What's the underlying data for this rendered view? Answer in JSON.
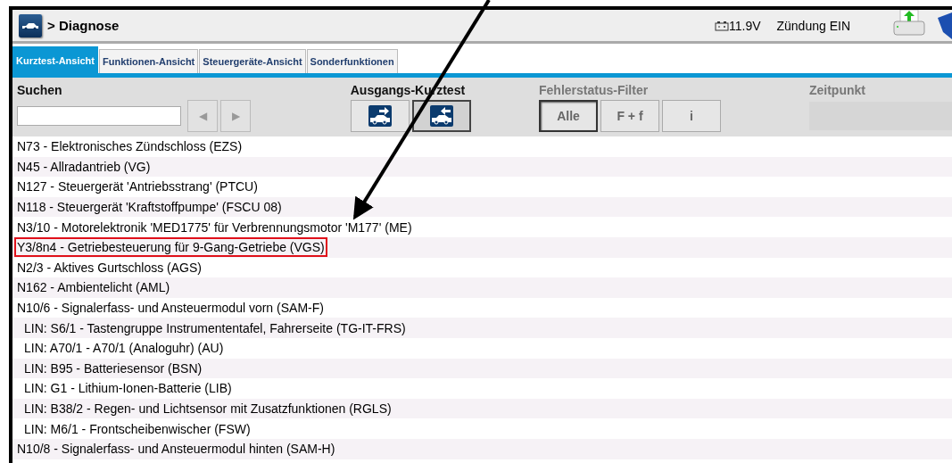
{
  "header": {
    "breadcrumb": "> Diagnose",
    "voltage": "11.9V",
    "ignition": "Zündung EIN"
  },
  "tabs": [
    {
      "label": "Kurztest-Ansicht",
      "selected": true
    },
    {
      "label": "Funktionen-Ansicht",
      "selected": false
    },
    {
      "label": "Steuergeräte-Ansicht",
      "selected": false
    },
    {
      "label": "Sonderfunktionen",
      "selected": false
    }
  ],
  "search": {
    "label": "Suchen"
  },
  "nav_buttons": [
    {
      "symbol": "◀",
      "disabled": true
    },
    {
      "symbol": "▶",
      "disabled": true
    }
  ],
  "ausgangs_kurztest": {
    "label": "Ausgangs-Kurztest",
    "buttons": [
      {
        "kind": "outgoing",
        "selected": false
      },
      {
        "kind": "incoming",
        "selected": true
      }
    ]
  },
  "fehlerstatus_filter": {
    "label": "Fehlerstatus-Filter",
    "buttons": [
      {
        "label": "Alle",
        "selected": true
      },
      {
        "label": "F + f",
        "selected": false
      },
      {
        "label": "i",
        "selected": false
      }
    ]
  },
  "zeitpunkt": {
    "label": "Zeitpunkt"
  },
  "ecus": [
    {
      "label": "N73 - Elektronisches Zündschloss (EZS)",
      "highlighted": false
    },
    {
      "label": "N45 - Allradantrieb (VG)",
      "highlighted": false
    },
    {
      "label": "N127 - Steuergerät 'Antriebsstrang' (PTCU)",
      "highlighted": false
    },
    {
      "label": "N118 - Steuergerät 'Kraftstoffpumpe' (FSCU 08)",
      "highlighted": false
    },
    {
      "label": "N3/10 - Motorelektronik 'MED1775' für Verbrennungsmotor 'M177' (ME)",
      "highlighted": false
    },
    {
      "label": "Y3/8n4 - Getriebesteuerung für 9-Gang-Getriebe (VGS)",
      "highlighted": true
    },
    {
      "label": "N2/3 - Aktives Gurtschloss (AGS)",
      "highlighted": false
    },
    {
      "label": "N162 - Ambientelicht (AML)",
      "highlighted": false
    },
    {
      "label": "N10/6 - Signalerfass- und Ansteuermodul vorn (SAM-F)",
      "highlighted": false,
      "children": [
        {
          "label": "LIN: S6/1 - Tastengruppe Instrumententafel, Fahrerseite (TG-IT-FRS)",
          "highlighted": false
        },
        {
          "label": "LIN: A70/1 - A70/1 (Analoguhr) (AU)",
          "highlighted": false
        },
        {
          "label": "LIN: B95 - Batteriesensor (BSN)",
          "highlighted": false
        },
        {
          "label": "LIN: G1 - Lithium-Ionen-Batterie (LIB)",
          "highlighted": false
        },
        {
          "label": "LIN: B38/2 - Regen- und Lichtsensor mit Zusatzfunktionen (RGLS)",
          "highlighted": false
        },
        {
          "label": "LIN: M6/1 - Frontscheibenwischer (FSW)",
          "highlighted": false
        }
      ]
    },
    {
      "label": "N10/8 - Signalerfass- und Ansteuermodul hinten (SAM-H)",
      "highlighted": false
    }
  ]
}
